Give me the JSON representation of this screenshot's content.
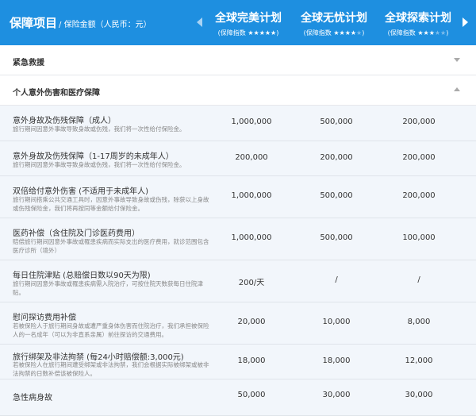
{
  "header": {
    "title": "保障项目",
    "subtitle": "/ 保险金额（人民币：元）",
    "plans": [
      {
        "name": "全球完美计划",
        "rating_label": "保障指数",
        "stars_on": 5,
        "stars_total": 5
      },
      {
        "name": "全球无忧计划",
        "rating_label": "保障指数",
        "stars_on": 4,
        "stars_total": 5
      },
      {
        "name": "全球探索计划",
        "rating_label": "保障指数",
        "stars_on": 3,
        "stars_total": 5
      }
    ]
  },
  "sections": [
    {
      "title": "紧急救援",
      "expanded": false
    },
    {
      "title": "个人意外伤害和医疗保障",
      "expanded": true
    }
  ],
  "rows": [
    {
      "name": "意外身故及伤残保障（成人）",
      "desc": "旅行期间因意外事故导致身故或伤残，我们将一次性给付保险金。",
      "values": [
        "1,000,000",
        "500,000",
        "200,000"
      ]
    },
    {
      "name": "意外身故及伤残保障（1-17周岁的未成年人）",
      "desc": "旅行期间因意外事故导致身故或伤残，我们将一次性给付保险金。",
      "values": [
        "200,000",
        "200,000",
        "200,000"
      ]
    },
    {
      "name": "双倍给付意外伤害 (不适用于未成年人)",
      "desc": "旅行期间搭乘公共交通工具时，因意外事故导致身故或伤残，除获以上身故或伤残保险金，我们将再按同等金额给付保险金。",
      "values": [
        "1,000,000",
        "500,000",
        "200,000"
      ]
    },
    {
      "name": "医药补偿（含住院及门诊医药费用）",
      "desc": "赔偿旅行期间因意外事故或罹患疾病而实际支出的医疗费用，就诊范围包含医疗诊所（境外）",
      "values": [
        "1,000,000",
        "500,000",
        "100,000"
      ]
    },
    {
      "name": "每日住院津贴 (总赔偿日数以90天为限)",
      "desc": "旅行期间因意外事故或罹患疾病需入院治疗，可按住院天数获每日住院津贴。",
      "values": [
        "200/天",
        "/",
        "/"
      ]
    },
    {
      "name": "慰问探访费用补偿",
      "desc": "若被保险人于旅行期间身故或遭严重身体伤害而住院治疗，我们承担被保险人的一名成年（可以为非直系亲属）前往探访的交通费用。",
      "values": [
        "20,000",
        "10,000",
        "8,000"
      ]
    },
    {
      "name": "旅行绑架及非法拘禁 (每24小时赔偿额:3,000元)",
      "desc": "若被保险人在旅行期间遭受绑架或非法拘禁，我们会根据实际被绑架或被非法拘禁的日数补偿该被保险人。",
      "values": [
        "18,000",
        "18,000",
        "12,000"
      ]
    },
    {
      "name": "急性病身故",
      "desc": "",
      "values": [
        "50,000",
        "30,000",
        "30,000"
      ]
    }
  ]
}
